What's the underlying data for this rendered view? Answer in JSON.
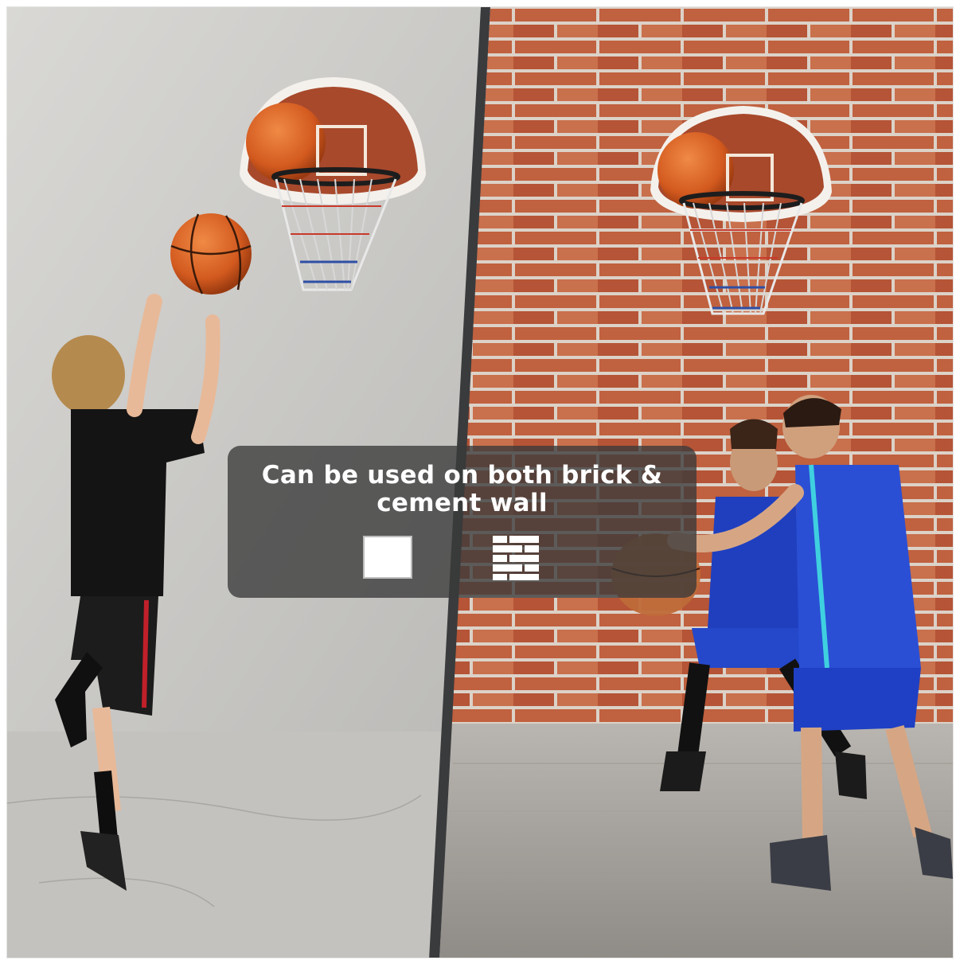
{
  "caption": {
    "text": "Can be used on both brick &\ncement wall"
  },
  "icons": {
    "cement": "cement-wall-icon",
    "brick": "brick-wall-icon"
  },
  "colors": {
    "cement_wall": "#c8c7c4",
    "brick": "#c0613f",
    "mortar": "#e0d6cc",
    "panel": "#3a3a3a",
    "divider": "#3a3b3d"
  }
}
